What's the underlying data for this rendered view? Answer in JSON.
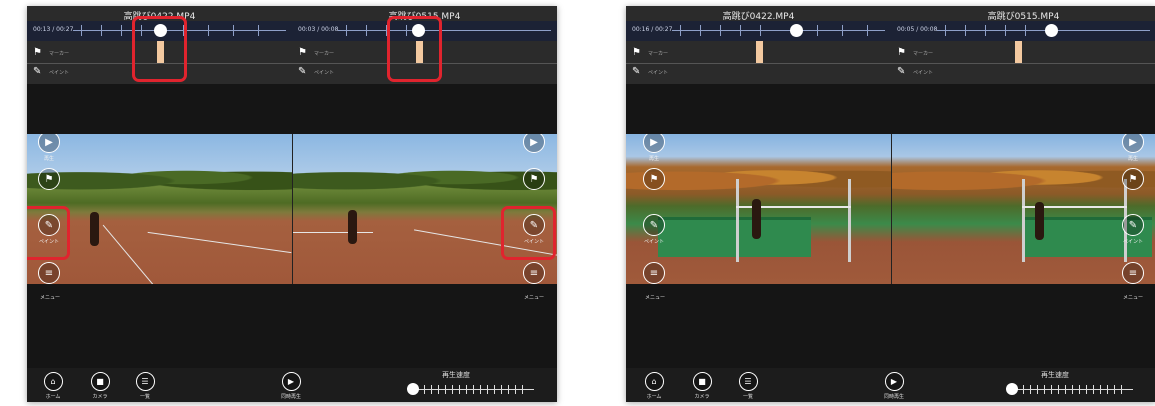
{
  "screens": [
    {
      "left_file": "高跳び0422.MP4",
      "left_time": "00:13 / 00:27",
      "right_file": "高跳び0515.MP4",
      "right_time": "00:03 / 00:08",
      "marker_label": "マーカー",
      "paint_label": "ペイント",
      "side_controls": [
        "再生",
        "マーカー",
        "ペイント",
        "メニュー"
      ],
      "bottom": {
        "home": "ホーム",
        "camera": "カメラ",
        "list": "一覧",
        "sync_play": "同時再生",
        "speed_label": "再生速度"
      }
    },
    {
      "left_file": "高跳び0422.MP4",
      "left_time": "00:16 / 00:27",
      "right_file": "高跳び0515.MP4",
      "right_time": "00:05 / 00:08",
      "marker_label": "マーカー",
      "paint_label": "ペイント",
      "side_controls": [
        "再生",
        "マーカー",
        "ペイント",
        "メニュー"
      ],
      "bottom": {
        "home": "ホーム",
        "camera": "カメラ",
        "list": "一覧",
        "sync_play": "同時再生",
        "speed_label": "再生速度"
      }
    }
  ],
  "icons": {
    "play": "play-icon",
    "flag": "flag-icon",
    "pencil": "pencil-icon",
    "menu": "menu-icon",
    "home": "home-icon",
    "camera": "camera-icon",
    "list": "list-icon"
  },
  "colors": {
    "highlight": "#e0242e",
    "marker": "#f3c9a0",
    "timeline": "#1c2235"
  }
}
